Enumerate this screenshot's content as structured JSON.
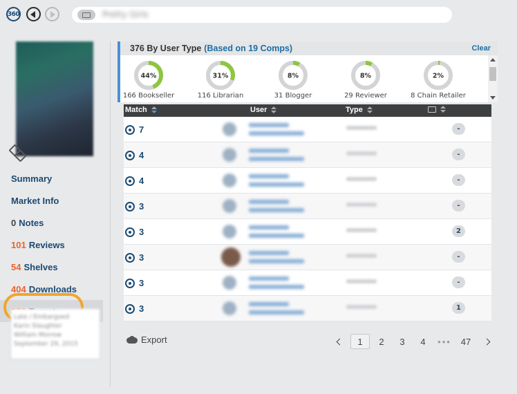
{
  "topbar": {
    "logo_text": "360",
    "search_text": "Pretty Girls",
    "icons": [
      "back-icon",
      "forward-icon",
      "book-icon"
    ]
  },
  "sidebar": {
    "items": [
      {
        "count": "",
        "label": "Summary"
      },
      {
        "count": "",
        "label": "Market Info"
      },
      {
        "count": "0",
        "label": "Notes"
      },
      {
        "count": "101",
        "label": "Reviews"
      },
      {
        "count": "54",
        "label": "Shelves"
      },
      {
        "count": "404",
        "label": "Downloads"
      },
      {
        "count": "376",
        "label": "Targets"
      }
    ],
    "active_item": "Targets",
    "info_lines": [
      "Late / Embargoed",
      "Karin Slaughter",
      "William Morrow",
      "September 29, 2015"
    ]
  },
  "summary": {
    "title": "376 By User Type",
    "subtitle": "(Based on 19 Comps)",
    "clear_label": "Clear",
    "segments": [
      {
        "pct_label": "44%",
        "pct": 44,
        "label": "166 Bookseller"
      },
      {
        "pct_label": "31%",
        "pct": 31,
        "label": "116 Librarian"
      },
      {
        "pct_label": "8%",
        "pct": 8,
        "label": "31 Blogger"
      },
      {
        "pct_label": "8%",
        "pct": 8,
        "label": "29 Reviewer"
      },
      {
        "pct_label": "2%",
        "pct": 2,
        "label": "8 Chain Retailer"
      }
    ],
    "colors": {
      "fill": "#8dc63f",
      "track": "#d3d4d6"
    }
  },
  "table": {
    "headers": {
      "match": "Match",
      "user": "User",
      "type": "Type"
    },
    "rows": [
      {
        "match": "7",
        "user_line1": "Username",
        "user_line2": "Account Name",
        "type": "Unknown",
        "notes": "-",
        "photo": false
      },
      {
        "match": "4",
        "user_line1": "Username",
        "user_line2": "Account Name",
        "type": "Unknown",
        "notes": "-",
        "photo": false
      },
      {
        "match": "4",
        "user_line1": "Username",
        "user_line2": "Account Name",
        "type": "Unknown",
        "notes": "-",
        "photo": false
      },
      {
        "match": "3",
        "user_line1": "Username",
        "user_line2": "Account Name",
        "type": "Unknown",
        "notes": "-",
        "photo": false
      },
      {
        "match": "3",
        "user_line1": "Username",
        "user_line2": "Account Name",
        "type": "Unknown",
        "notes": "2",
        "photo": false
      },
      {
        "match": "3",
        "user_line1": "Username",
        "user_line2": "Account Name",
        "type": "Unknown",
        "notes": "-",
        "photo": true
      },
      {
        "match": "3",
        "user_line1": "Username",
        "user_line2": "Account Name",
        "type": "Unknown",
        "notes": "-",
        "photo": false
      },
      {
        "match": "3",
        "user_line1": "Username",
        "user_line2": "Account Name",
        "type": "Unknown",
        "notes": "1",
        "photo": false
      }
    ]
  },
  "footer": {
    "export_label": "Export",
    "pages": [
      "1",
      "2",
      "3",
      "4"
    ],
    "ellipsis": "•••",
    "last_page": "47",
    "current_page": "1"
  }
}
